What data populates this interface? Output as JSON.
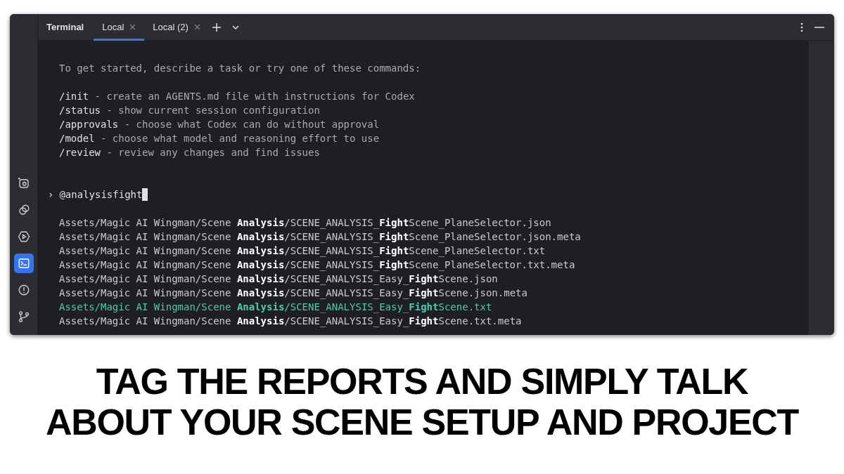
{
  "tool_window": {
    "title": "Terminal"
  },
  "tabs": [
    {
      "label": "Local",
      "selected": true
    },
    {
      "label": "Local (2)",
      "selected": false
    }
  ],
  "sidebar": {
    "items": [
      {
        "kind": "ai",
        "selected": false
      },
      {
        "kind": "services",
        "selected": false
      },
      {
        "kind": "run",
        "selected": false
      },
      {
        "kind": "terminal",
        "selected": true
      },
      {
        "kind": "problems",
        "selected": false
      },
      {
        "kind": "git",
        "selected": false
      }
    ]
  },
  "terminal": {
    "intro": "To get started, describe a task or try one of these commands:",
    "commands": [
      {
        "command": "/init",
        "description": " - create an AGENTS.md file with instructions for Codex"
      },
      {
        "command": "/status",
        "description": " - show current session configuration"
      },
      {
        "command": "/approvals",
        "description": " - choose what Codex can do without approval"
      },
      {
        "command": "/model",
        "description": " - choose what model and reasoning effort to use"
      },
      {
        "command": "/review",
        "description": " - review any changes and find issues"
      }
    ],
    "prompt": {
      "symbol": "›",
      "value": "@analysisfight"
    },
    "suggestions": [
      {
        "text": "Assets/Magic AI Wingman/Scene **Analysis**/SCENE_ANALYSIS_**Fight**Scene_PlaneSelector.json",
        "selected": false
      },
      {
        "text": "Assets/Magic AI Wingman/Scene **Analysis**/SCENE_ANALYSIS_**Fight**Scene_PlaneSelector.json.meta",
        "selected": false
      },
      {
        "text": "Assets/Magic AI Wingman/Scene **Analysis**/SCENE_ANALYSIS_**Fight**Scene_PlaneSelector.txt",
        "selected": false
      },
      {
        "text": "Assets/Magic AI Wingman/Scene **Analysis**/SCENE_ANALYSIS_**Fight**Scene_PlaneSelector.txt.meta",
        "selected": false
      },
      {
        "text": "Assets/Magic AI Wingman/Scene **Analysis**/SCENE_ANALYSIS_Easy_**Fight**Scene.json",
        "selected": false
      },
      {
        "text": "Assets/Magic AI Wingman/Scene **Analysis**/SCENE_ANALYSIS_Easy_**Fight**Scene.json.meta",
        "selected": false
      },
      {
        "text": "Assets/Magic AI Wingman/Scene **Analysis**/SCENE_ANALYSIS_Easy_**Fight**Scene.txt",
        "selected": true
      },
      {
        "text": "Assets/Magic AI Wingman/Scene **Analysis**/SCENE_ANALYSIS_Easy_**Fight**Scene.txt.meta",
        "selected": false
      }
    ]
  },
  "caption": [
    "TAG THE REPORTS AND SIMPLY TALK",
    "ABOUT YOUR SCENE SETUP AND PROJECT"
  ]
}
